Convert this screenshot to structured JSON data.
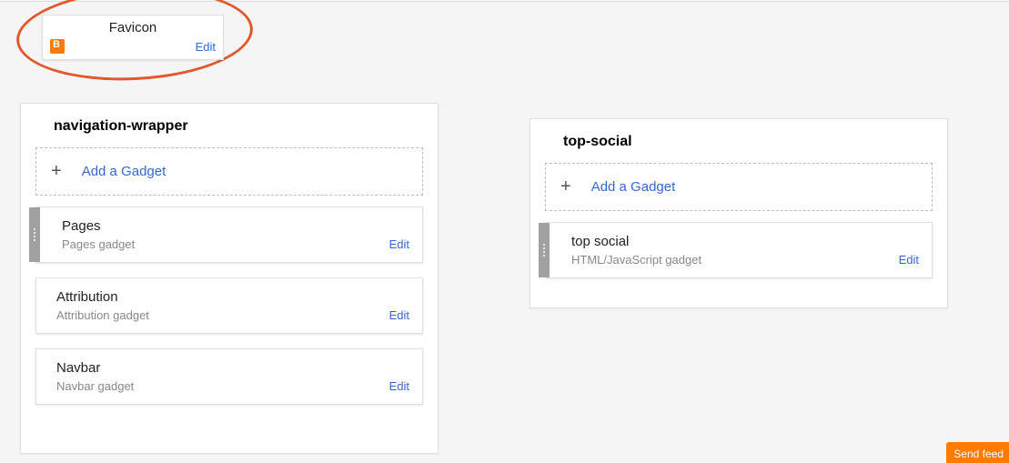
{
  "favicon": {
    "title": "Favicon",
    "edit": "Edit"
  },
  "panels": {
    "navigation": {
      "title": "navigation-wrapper",
      "add_label": "Add a Gadget",
      "gadgets": [
        {
          "title": "Pages",
          "subtitle": "Pages gadget",
          "edit": "Edit"
        },
        {
          "title": "Attribution",
          "subtitle": "Attribution gadget",
          "edit": "Edit"
        },
        {
          "title": "Navbar",
          "subtitle": "Navbar gadget",
          "edit": "Edit"
        }
      ]
    },
    "social": {
      "title": "top-social",
      "add_label": "Add a Gadget",
      "gadgets": [
        {
          "title": "top social",
          "subtitle": "HTML/JavaScript gadget",
          "edit": "Edit"
        }
      ]
    }
  },
  "footer": {
    "send_feedback": "Send feed"
  }
}
